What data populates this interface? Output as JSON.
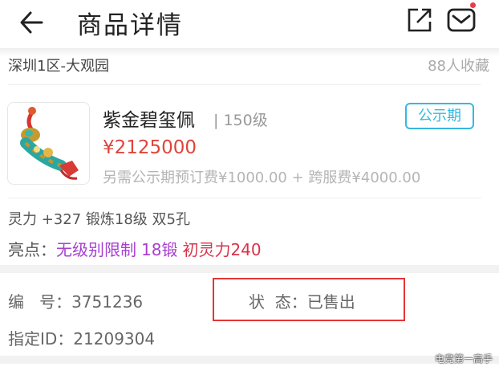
{
  "header": {
    "title": "商品详情",
    "icons": {
      "back": "back-arrow-icon",
      "share": "share-icon",
      "mail": "mail-icon"
    },
    "notification_dot_color": "#f0384a"
  },
  "seller": {
    "location": "深圳1区-大观园",
    "favorites": "88人收藏"
  },
  "item": {
    "image_icon": "jade-pendant-icon",
    "name": "紫金碧玺佩",
    "level": "| 150级",
    "badge": "公示期",
    "price": "¥2125000",
    "fees": "另需公示期预订费¥1000.00 + 跨服费¥4000.00"
  },
  "attributes": {
    "stats": "灵力 +327 锻炼18级 双5孔",
    "highlights_label": "亮点：",
    "highlights": [
      "无级别限制",
      "18锻",
      "初灵力240"
    ]
  },
  "details": {
    "number": "编   号：3751236",
    "status": "状  态：已售出",
    "trade_id": "指定ID：21209304"
  },
  "watermark": "电竞第一高手",
  "colors": {
    "price": "#e0443a",
    "badge": "#35b8e0",
    "highlight_purple": "#a73fd0",
    "highlight_red": "#d8334a",
    "annotation_box": "#e53535"
  }
}
